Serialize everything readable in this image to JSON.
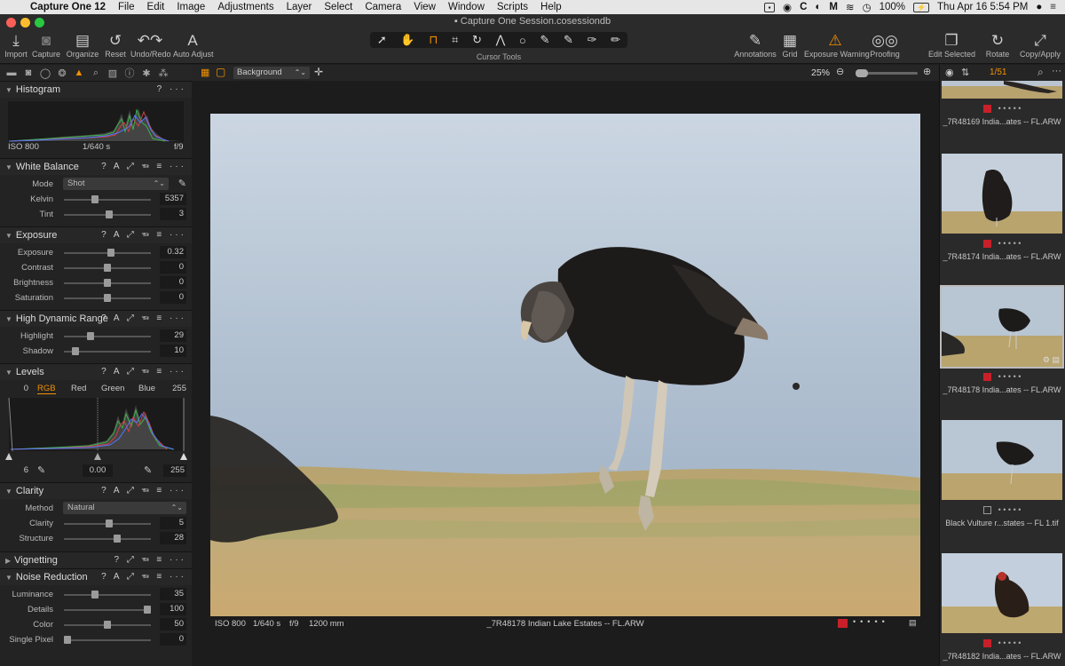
{
  "menubar": {
    "apple": "",
    "items": [
      "Capture One 12",
      "File",
      "Edit",
      "Image",
      "Adjustments",
      "Layer",
      "Select",
      "Camera",
      "View",
      "Window",
      "Scripts",
      "Help"
    ],
    "battery": "100%",
    "datetime": "Thu Apr 16  5:54 PM"
  },
  "window": {
    "title": "Capture One Session.cosessiondb"
  },
  "toolbar": {
    "left": [
      {
        "label": "Import",
        "icon": "⤓"
      },
      {
        "label": "Capture",
        "icon": "◙"
      },
      {
        "label": "Organize",
        "icon": "▤"
      },
      {
        "label": "Reset",
        "icon": "↺"
      },
      {
        "label": "Undo/Redo",
        "icon": "↶↷"
      },
      {
        "label": "Auto Adjust",
        "icon": "A"
      }
    ],
    "cursor_tools_label": "Cursor Tools",
    "right": [
      {
        "label": "Annotations",
        "icon": "✎"
      },
      {
        "label": "Grid",
        "icon": "▦"
      },
      {
        "label": "Exposure Warning",
        "icon": "⚠"
      },
      {
        "label": "Proofing",
        "icon": "◎◎"
      },
      {
        "label": "Edit Selected",
        "icon": "❐"
      },
      {
        "label": "Rotate",
        "icon": "↻"
      },
      {
        "label": "Copy/Apply",
        "icon": "⤢"
      }
    ]
  },
  "viewer_bar": {
    "background_select": "Background",
    "zoom": "25%"
  },
  "histogram": {
    "title": "Histogram",
    "iso": "ISO 800",
    "shutter": "1/640 s",
    "aperture": "f/9"
  },
  "white_balance": {
    "title": "White Balance",
    "mode_label": "Mode",
    "mode_value": "Shot",
    "kelvin_label": "Kelvin",
    "kelvin": "5357",
    "tint_label": "Tint",
    "tint": "3"
  },
  "exposure": {
    "title": "Exposure",
    "rows": [
      {
        "label": "Exposure",
        "value": "0.32",
        "pos": 0.54
      },
      {
        "label": "Contrast",
        "value": "0",
        "pos": 0.5
      },
      {
        "label": "Brightness",
        "value": "0",
        "pos": 0.5
      },
      {
        "label": "Saturation",
        "value": "0",
        "pos": 0.5
      }
    ]
  },
  "hdr": {
    "title": "High Dynamic Range",
    "rows": [
      {
        "label": "Highlight",
        "value": "29",
        "pos": 0.29
      },
      {
        "label": "Shadow",
        "value": "10",
        "pos": 0.1
      }
    ]
  },
  "levels": {
    "title": "Levels",
    "in_low": "0",
    "in_high": "255",
    "channels": [
      "RGB",
      "Red",
      "Green",
      "Blue"
    ],
    "out_low": "6",
    "mid": "0.00",
    "out_high": "255"
  },
  "clarity": {
    "title": "Clarity",
    "method_label": "Method",
    "method_value": "Natural",
    "rows": [
      {
        "label": "Clarity",
        "value": "5",
        "pos": 0.52
      },
      {
        "label": "Structure",
        "value": "28",
        "pos": 0.62
      }
    ]
  },
  "vignetting": {
    "title": "Vignetting"
  },
  "noise": {
    "title": "Noise Reduction",
    "rows": [
      {
        "label": "Luminance",
        "value": "35",
        "pos": 0.35
      },
      {
        "label": "Details",
        "value": "100",
        "pos": 1.0
      },
      {
        "label": "Color",
        "value": "50",
        "pos": 0.5
      },
      {
        "label": "Single Pixel",
        "value": "0",
        "pos": 0.0
      }
    ]
  },
  "viewer_info": {
    "iso": "ISO 800",
    "shutter": "1/640 s",
    "aperture": "f/9",
    "focal": "1200 mm",
    "filename": "_7R48178 Indian Lake Estates -- FL.ARW"
  },
  "browser": {
    "counter": "1/51",
    "thumbs": [
      {
        "caption": "_7R48169 India...ates -- FL.ARW",
        "tag": "red"
      },
      {
        "caption": "_7R48174 India...ates -- FL.ARW",
        "tag": "red"
      },
      {
        "caption": "_7R48178 India...ates -- FL.ARW",
        "tag": "red"
      },
      {
        "caption": "Black Vulture r...states -- FL 1.tif",
        "tag": "none"
      },
      {
        "caption": "_7R48182 India...ates -- FL.ARW",
        "tag": "red"
      }
    ]
  },
  "colors": {
    "accent": "#f29100",
    "tag_red": "#c8202a"
  }
}
